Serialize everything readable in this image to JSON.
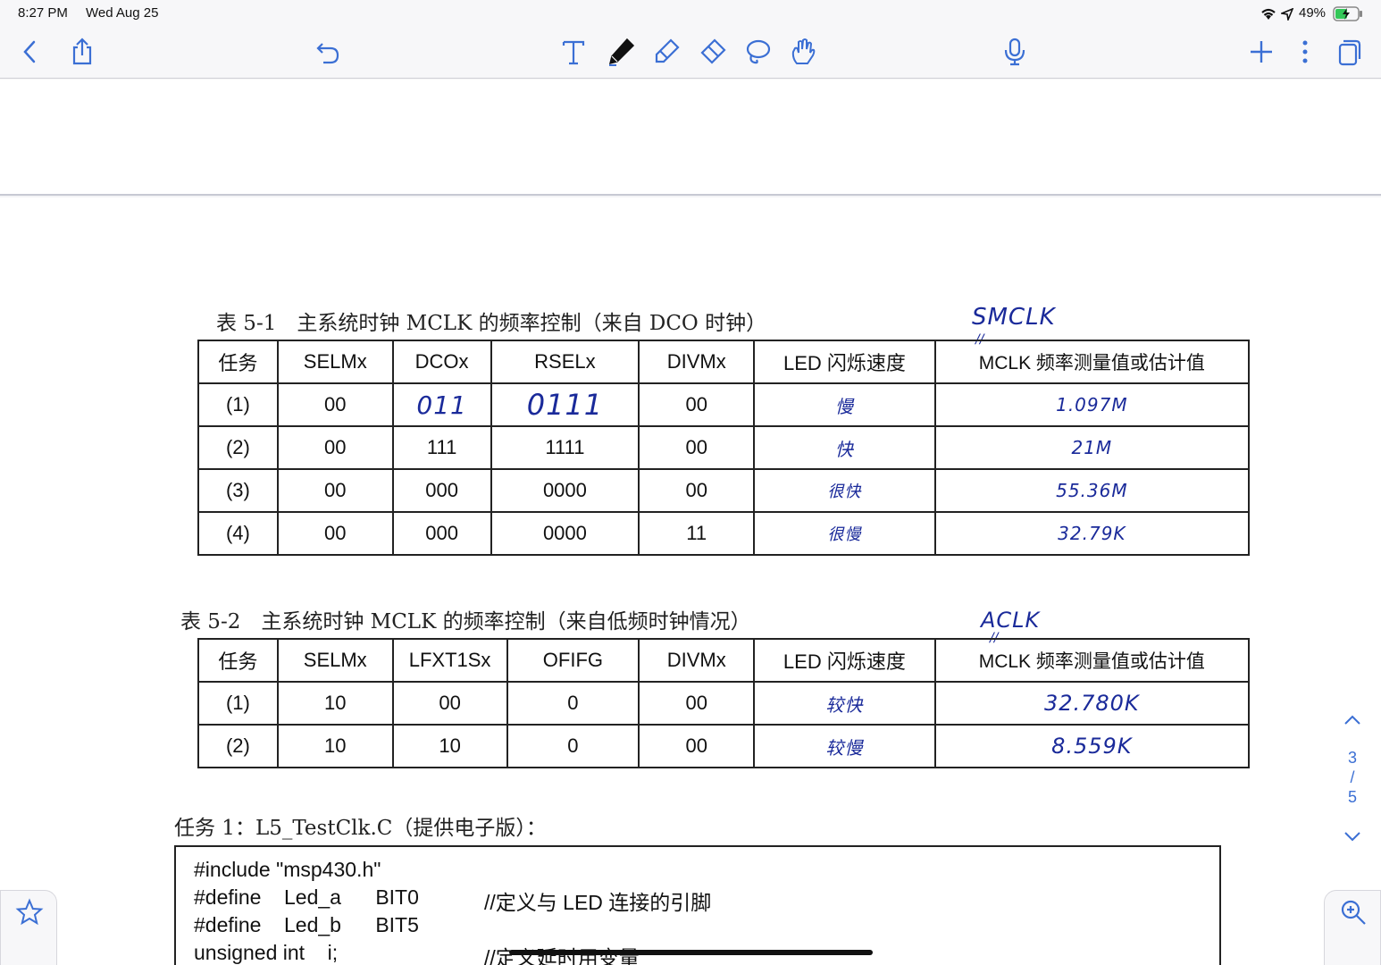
{
  "status_bar": {
    "time": "8:27 PM",
    "date": "Wed Aug 25",
    "battery": "49%"
  },
  "toolbar": {
    "icons": [
      "back-icon",
      "share-icon",
      "undo-icon",
      "text-tool-icon",
      "pen-tool-icon",
      "highlighter-tool-icon",
      "eraser-tool-icon",
      "lasso-tool-icon",
      "hand-tool-icon",
      "microphone-icon",
      "add-icon",
      "more-icon",
      "pages-icon"
    ],
    "accent": "#3b6fd4"
  },
  "table1": {
    "caption": "表 5-1　主系统时钟 MCLK 的频率控制（来自 DCO 时钟）",
    "annotation": "SMCLK",
    "headers": [
      "任务",
      "SELMx",
      "DCOx",
      "RSELx",
      "DIVMx",
      "LED 闪烁速度",
      "MCLK 频率测量值或估计值"
    ],
    "rows": [
      [
        "(1)",
        "00",
        "011",
        "0111",
        "00",
        "慢",
        "1.097M"
      ],
      [
        "(2)",
        "00",
        "111",
        "1111",
        "00",
        "快",
        "21M"
      ],
      [
        "(3)",
        "00",
        "000",
        "0000",
        "00",
        "很快",
        "55.36M"
      ],
      [
        "(4)",
        "00",
        "000",
        "0000",
        "11",
        "很慢",
        "32.79K"
      ]
    ]
  },
  "table2": {
    "caption": "表 5-2　主系统时钟 MCLK 的频率控制（来自低频时钟情况）",
    "annotation": "ACLK",
    "headers": [
      "任务",
      "SELMx",
      "LFXT1Sx",
      "OFIFG",
      "DIVMx",
      "LED 闪烁速度",
      "MCLK 频率测量值或估计值"
    ],
    "rows": [
      [
        "(1)",
        "10",
        "00",
        "0",
        "00",
        "较快",
        "32.780K"
      ],
      [
        "(2)",
        "10",
        "10",
        "0",
        "00",
        "较慢",
        "8.559K"
      ]
    ]
  },
  "task1": {
    "title": "任务 1：L5_TestClk.C（提供电子版）：",
    "code": [
      {
        "code": "#include \"msp430.h\"",
        "comment": ""
      },
      {
        "code": "#define    Led_a      BIT0",
        "comment": "//定义与 LED 连接的引脚"
      },
      {
        "code": "#define    Led_b      BIT5",
        "comment": ""
      },
      {
        "code": "unsigned int    i;",
        "comment": "//定义延时用变量"
      }
    ]
  },
  "page_nav": {
    "current": "3",
    "separator": "/",
    "total": "5"
  }
}
